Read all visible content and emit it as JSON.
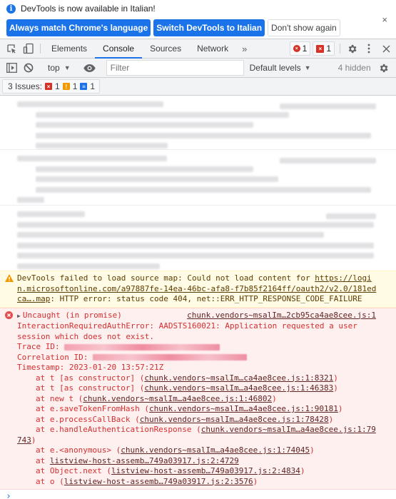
{
  "infobar": {
    "message": "DevTools is now available in Italian!",
    "buttons": {
      "match": "Always match Chrome's language",
      "switch": "Switch DevTools to Italian",
      "dismiss": "Don't show again"
    },
    "close_icon": "×"
  },
  "tabbar": {
    "tabs": [
      "Elements",
      "Console",
      "Sources",
      "Network"
    ],
    "active_tab": "Console",
    "more_icon": "»",
    "error_count": "1",
    "issue_count": "1"
  },
  "console_toolbar": {
    "context": "top",
    "filter_placeholder": "Filter",
    "levels": "Default levels",
    "hidden": "4 hidden"
  },
  "issues": {
    "label": "3 Issues:",
    "errors": "1",
    "warnings": "1",
    "info": "1",
    "colors": {
      "error": "#d93025",
      "warning": "#f29900",
      "info": "#1a73e8"
    }
  },
  "warning": {
    "text_prefix": "DevTools failed to load source map: Could not load content for ",
    "link_line1": "https://logi",
    "link_line2": "n.microsoftonline.com/a97887fe-14ea-46bc-afa8-f7b85f2164ff/oauth2/v2.0/181ed",
    "link_line3": "ca….map",
    "text_suffix": ": HTTP error: status code 404, net::ERR_HTTP_RESPONSE_CODE_FAILURE"
  },
  "error": {
    "title": "Uncaught (in promise)",
    "source": "chunk.vendors~msalIm…2cb95ca4ae8cee.js:1",
    "line1": "InteractionRequiredAuthError: AADSTS160021: Application requested a user",
    "line2": "session which does not exist.",
    "trace_label": "Trace ID: ",
    "correlation_label": "Correlation ID: ",
    "timestamp": "Timestamp: 2023-01-20 13:57:21Z",
    "stack": [
      {
        "prefix": "at t [as constructor] (",
        "link": "chunk.vendors~msalIm…ca4ae8cee.js:1:8321",
        "suffix": ")"
      },
      {
        "prefix": "at t [as constructor] (",
        "link": "chunk.vendors~msalIm…a4ae8cee.js:1:46383",
        "suffix": ")"
      },
      {
        "prefix": "at new t (",
        "link": "chunk.vendors~msalIm…a4ae8cee.js:1:46802",
        "suffix": ")"
      },
      {
        "prefix": "at e.saveTokenFromHash (",
        "link": "chunk.vendors~msalIm…a4ae8cee.js:1:90181",
        "suffix": ")"
      },
      {
        "prefix": "at e.processCallBack (",
        "link": "chunk.vendors~msalIm…a4ae8cee.js:1:78428",
        "suffix": ")"
      },
      {
        "prefix": "at e.handleAuthenticationResponse (",
        "link": "chunk.vendors~msalIm…a4ae8cee.js:1:79",
        "suffix": ""
      },
      {
        "prefix": "",
        "link": "743",
        "suffix": ")",
        "wrap": true
      },
      {
        "prefix": "at e.<anonymous> (",
        "link": "chunk.vendors~msalIm…a4ae8cee.js:1:74045",
        "suffix": ")"
      },
      {
        "prefix": "at ",
        "link": "listview-host-assemb…749a03917.js:2:4729",
        "suffix": ""
      },
      {
        "prefix": "at Object.next (",
        "link": "listview-host-assemb…749a03917.js:2:4834",
        "suffix": ")"
      },
      {
        "prefix": "at o (",
        "link": "listview-host-assemb…749a03917.js:2:3576",
        "suffix": ")"
      }
    ]
  },
  "prompt_symbol": "›"
}
